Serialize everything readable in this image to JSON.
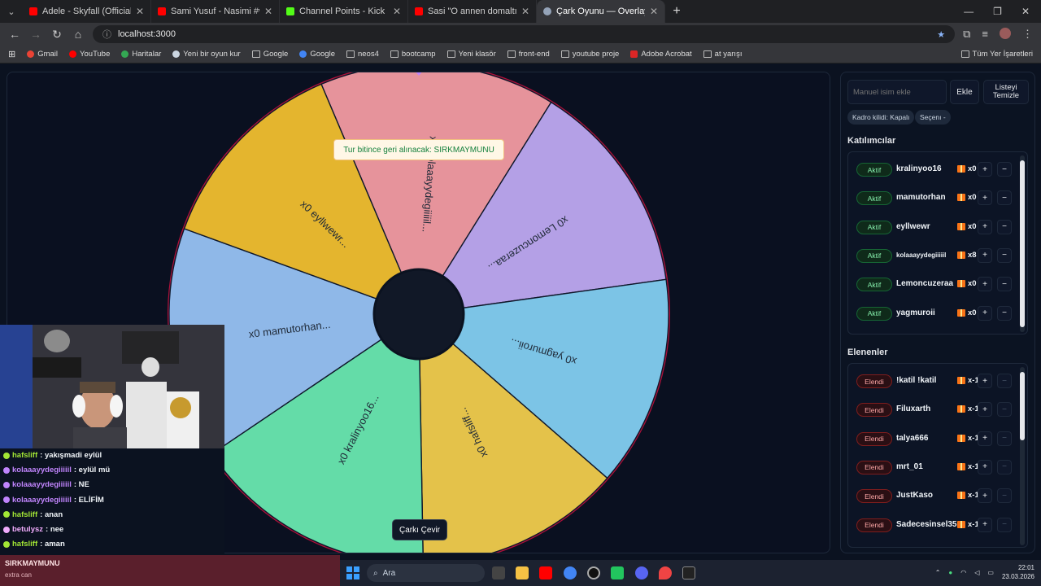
{
  "browser": {
    "tabs": [
      {
        "title": "Adele - Skyfall (Official Lyric",
        "color": "#ff0000",
        "active": false
      },
      {
        "title": "Sami Yusuf - Nasimi #worldmu",
        "color": "#ff0000",
        "active": false
      },
      {
        "title": "Channel Points - Kick Dashboar",
        "color": "#53fc18",
        "active": false
      },
      {
        "title": "Sasi \"O annen domaltılacak\" diy",
        "color": "#ff0000",
        "active": false
      },
      {
        "title": "Çark Oyunu — Overlay",
        "color": "#94a3b8",
        "active": true
      }
    ],
    "url": "localhost:3000",
    "bookmarks": [
      {
        "label": "Gmail",
        "color": "#ea4335"
      },
      {
        "label": "YouTube",
        "color": "#ff0000"
      },
      {
        "label": "Haritalar",
        "color": "#34a853"
      },
      {
        "label": "Yeni bir oyun kur",
        "color": "#cbd5e1"
      },
      {
        "label": "Google",
        "color": "folder"
      },
      {
        "label": "Google",
        "color": "#4285f4"
      },
      {
        "label": "neos4",
        "color": "folder"
      },
      {
        "label": "bootcamp",
        "color": "folder"
      },
      {
        "label": "Yeni klasör",
        "color": "folder"
      },
      {
        "label": "front-end",
        "color": "folder"
      },
      {
        "label": "youtube proje",
        "color": "folder"
      },
      {
        "label": "Adobe Acrobat",
        "color": "#dc2626"
      },
      {
        "label": "at yarışı",
        "color": "folder"
      }
    ],
    "bookmarks_right": "Tüm Yer İşaretleri"
  },
  "wheel": {
    "segments": [
      {
        "label": "x8 kolaaayydegiiiiil...",
        "color": "#e6939b"
      },
      {
        "label": "x0 Lemoncuzeraa...",
        "color": "#b4a0e6"
      },
      {
        "label": "x0 yagmuroii...",
        "color": "#7cc4e6"
      },
      {
        "label": "x0 hafsliff...",
        "color": "#e4c24a"
      },
      {
        "label": "x0 kralinyoo16...",
        "color": "#64dca8"
      },
      {
        "label": "x0 mamutorhan...",
        "color": "#8fb8e8"
      },
      {
        "label": "x0 eyllwewr...",
        "color": "#e4b52e"
      }
    ],
    "toast": "Tur bitince geri alınacak: SIRKMAYMUNU",
    "spin_button": "Çarkı Çevir"
  },
  "side": {
    "name_placeholder": "Manuel isim ekle",
    "add_label": "Ekle",
    "clear_label": "Listeyi Temizle",
    "chip_lock": "Kadro kilidi: Kapalı",
    "chip_select": "Seçenı -",
    "participants_title": "Katılımcılar",
    "eliminated_title": "Elenenler",
    "participants": [
      {
        "status": "Aktif",
        "name": "kralinyoo16",
        "mult": "x0"
      },
      {
        "status": "Aktif",
        "name": "mamutorhan",
        "mult": "x0"
      },
      {
        "status": "Aktif",
        "name": "eyllwewr",
        "mult": "x0"
      },
      {
        "status": "Aktif",
        "name": "kolaaayydegiiiiil",
        "mult": "x8"
      },
      {
        "status": "Aktif",
        "name": "Lemoncuzeraa",
        "mult": "x0"
      },
      {
        "status": "Aktif",
        "name": "yagmuroii",
        "mult": "x0"
      }
    ],
    "eliminated": [
      {
        "status": "Elendi",
        "name": "!katil !katil",
        "mult": "x-1"
      },
      {
        "status": "Elendi",
        "name": "Filuxarth",
        "mult": "x-1"
      },
      {
        "status": "Elendi",
        "name": "talya666",
        "mult": "x-1"
      },
      {
        "status": "Elendi",
        "name": "mrt_01",
        "mult": "x-1"
      },
      {
        "status": "Elendi",
        "name": "JustKaso",
        "mult": "x-1"
      },
      {
        "status": "Elendi",
        "name": "Sadecesinsel35",
        "mult": "x-1"
      }
    ],
    "plus": "+",
    "minus": "−"
  },
  "chat": [
    {
      "name": "hafsliff",
      "msg": ": yakışmadi eylül",
      "color": "#a3e635"
    },
    {
      "name": "kolaaayydegiiiiil",
      "msg": ": eylül mü",
      "color": "#c084fc"
    },
    {
      "name": "kolaaayydegiiiiil",
      "msg": ": NE",
      "color": "#c084fc"
    },
    {
      "name": "kolaaayydegiiiiil",
      "msg": ": ELİFİM",
      "color": "#c084fc"
    },
    {
      "name": "hafsliff",
      "msg": ": anan",
      "color": "#a3e635"
    },
    {
      "name": "betulysz",
      "msg": ": nee",
      "color": "#f0abfc"
    },
    {
      "name": "hafsliff",
      "msg": ": aman",
      "color": "#a3e635"
    }
  ],
  "donation": {
    "name": "SIRKMAYMUNU",
    "sub": "extra can"
  },
  "taskbar": {
    "search": "Ara",
    "time": "22:01",
    "date": "23.03.2026"
  }
}
